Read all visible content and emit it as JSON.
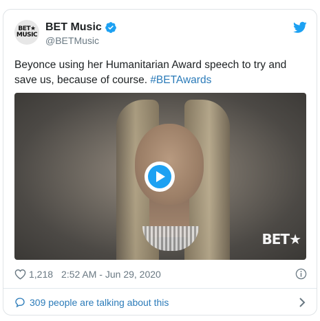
{
  "author": {
    "display_name": "BET Music",
    "handle": "@BETMusic",
    "avatar_text_line1": "BET★",
    "avatar_text_line2": "MUSIC",
    "verified": true
  },
  "tweet": {
    "text": "Beyonce using her Humanitarian Award speech to try and save us, because of course. ",
    "hashtag": "#BETAwards"
  },
  "media": {
    "type": "video",
    "watermark": "BET★"
  },
  "meta": {
    "likes": "1,218",
    "timestamp": "2:52 AM - Jun 29, 2020"
  },
  "footer": {
    "talking_label": "309 people are talking about this"
  },
  "icons": {
    "twitter": "twitter-bird-icon",
    "verified": "verified-badge-icon",
    "heart": "heart-icon",
    "info": "info-icon",
    "reply_bubble": "comment-bubble-icon",
    "chevron": "chevron-right-icon",
    "play": "play-icon"
  },
  "colors": {
    "accent": "#1da1f2",
    "link": "#2b7bb9",
    "secondary_text": "#697882",
    "border": "#dfe3e6"
  }
}
